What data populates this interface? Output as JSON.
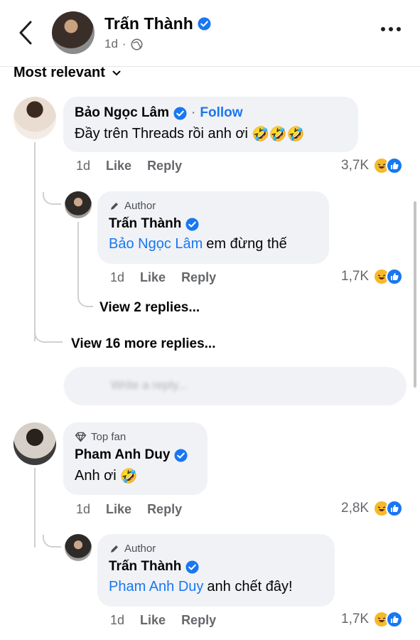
{
  "header": {
    "name": "Trấn Thành",
    "time": "1d",
    "privacy_icon": "globe-icon"
  },
  "sort": {
    "label": "Most relevant"
  },
  "comments": [
    {
      "author": "Bảo Ngọc Lâm",
      "follow": "Follow",
      "text": "Đầy trên Threads rồi anh ơi",
      "emoji": "🤣🤣🤣",
      "time": "1d",
      "like": "Like",
      "reply": "Reply",
      "reactions": "3,7K",
      "replies": [
        {
          "badge": "Author",
          "author": "Trấn Thành",
          "mention": "Bảo Ngọc Lâm",
          "text": "em đừng thế",
          "time": "1d",
          "like": "Like",
          "reply": "Reply",
          "reactions": "1,7K"
        }
      ],
      "view_nested": "View 2 replies...",
      "view_more": "View 16 more replies..."
    },
    {
      "badge": "Top fan",
      "author": "Pham Anh Duy",
      "text": "Anh ơi",
      "emoji": "🤣",
      "time": "1d",
      "like": "Like",
      "reply": "Reply",
      "reactions": "2,8K",
      "replies": [
        {
          "badge": "Author",
          "author": "Trấn Thành",
          "mention": "Pham Anh Duy",
          "text": "anh chết đây!",
          "time": "1d",
          "like": "Like",
          "reply": "Reply",
          "reactions": "1,7K"
        }
      ]
    }
  ],
  "reply_input": {
    "placeholder": "Write a reply..."
  },
  "colors": {
    "accent": "#1877f2",
    "bubble": "#f0f2f5",
    "muted": "#65676b"
  }
}
